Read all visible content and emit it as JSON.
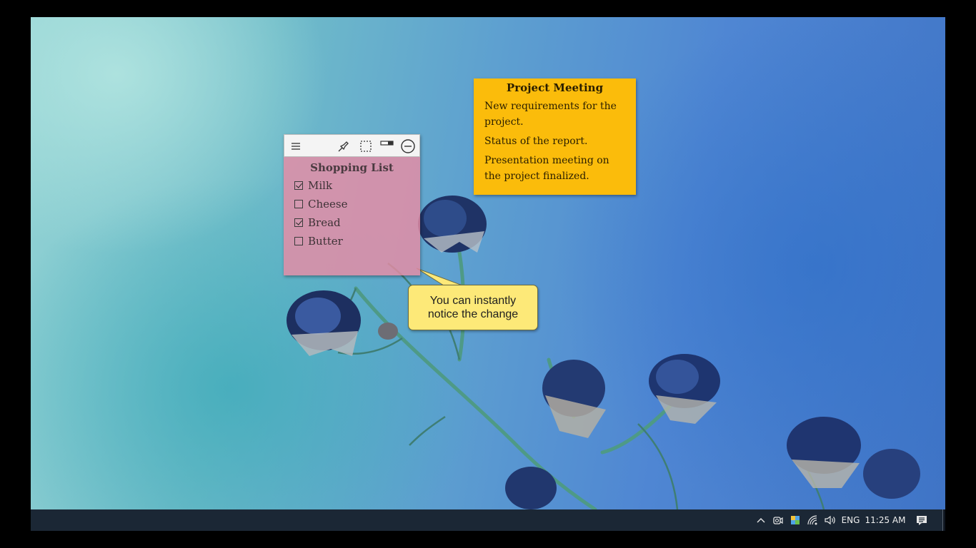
{
  "desktop": {
    "sticky_shopping": {
      "title": "Shopping List",
      "color": "#e88ca5",
      "toolbar_icons": [
        "menu-icon",
        "pin-icon",
        "select-region-icon",
        "opacity-icon",
        "minimize-icon"
      ],
      "items": [
        {
          "label": "Milk",
          "checked": true
        },
        {
          "label": "Cheese",
          "checked": false
        },
        {
          "label": "Bread",
          "checked": true
        },
        {
          "label": "Butter",
          "checked": false
        }
      ]
    },
    "sticky_meeting": {
      "title": "Project Meeting",
      "color": "#fbbc0b",
      "lines": [
        "New requirements for the project.",
        "Status of the report.",
        "Presentation meeting on the project finalized."
      ]
    },
    "callout": {
      "line1": "You can instantly",
      "line2": "notice the change",
      "color": "#fde978"
    }
  },
  "taskbar": {
    "tray_icons": [
      "chevron-up-icon",
      "meet-now-icon",
      "windows-security-icon",
      "network-icon",
      "volume-icon",
      "notifications-icon"
    ],
    "language": "ENG",
    "time": "11:25 AM"
  }
}
